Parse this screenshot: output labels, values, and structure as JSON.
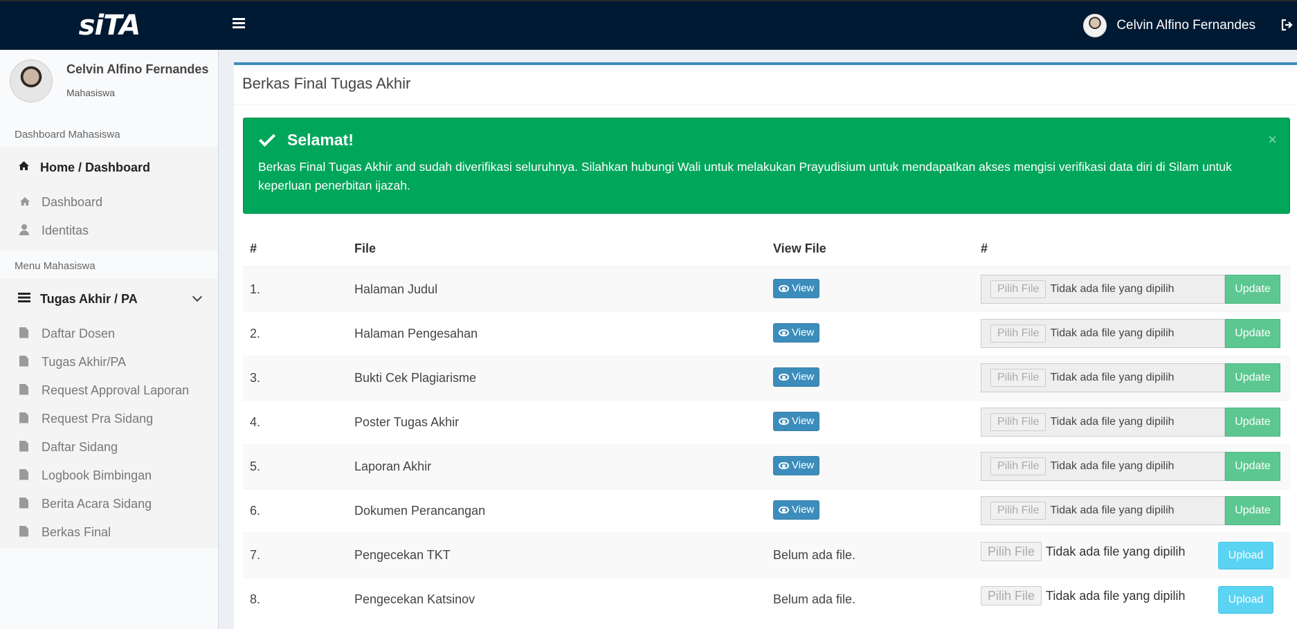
{
  "app": {
    "logo": "siTA",
    "user_name": "Celvin Alfino Fernandes"
  },
  "sidebar": {
    "user_name": "Celvin Alfino Fernandes",
    "user_role": "Mahasiswa",
    "section1": "Dashboard Mahasiswa",
    "home_label": "Home / Dashboard",
    "home_items": [
      {
        "label": "Dashboard",
        "icon": "home-icon"
      },
      {
        "label": "Identitas",
        "icon": "user-icon"
      }
    ],
    "section2": "Menu Mahasiswa",
    "ta_label": "Tugas Akhir / PA",
    "ta_items": [
      {
        "label": "Daftar Dosen"
      },
      {
        "label": "Tugas Akhir/PA"
      },
      {
        "label": "Request Approval Laporan"
      },
      {
        "label": "Request Pra Sidang"
      },
      {
        "label": "Daftar Sidang"
      },
      {
        "label": "Logbook Bimbingan"
      },
      {
        "label": "Berita Acara Sidang"
      },
      {
        "label": "Berkas Final"
      }
    ]
  },
  "main": {
    "title": "Berkas Final Tugas Akhir",
    "alert": {
      "heading": "Selamat!",
      "text": "Berkas Final Tugas Akhir and sudah diverifikasi seluruhnya. Silahkan hubungi Wali untuk melakukan Prayudisium untuk mendapatkan akses mengisi verifikasi data diri di Silam untuk keperluan penerbitan ijazah.",
      "close": "×",
      "color": "#00a65a"
    },
    "table": {
      "headers": [
        "#",
        "File",
        "View File",
        "#"
      ],
      "rows": [
        {
          "no": "1.",
          "file": "Halaman Judul",
          "view": "View",
          "choose": "Pilih File",
          "status": "Tidak ada file yang dipilih",
          "action": "Update"
        },
        {
          "no": "2.",
          "file": "Halaman Pengesahan",
          "view": "View",
          "choose": "Pilih File",
          "status": "Tidak ada file yang dipilih",
          "action": "Update"
        },
        {
          "no": "3.",
          "file": "Bukti Cek Plagiarisme",
          "view": "View",
          "choose": "Pilih File",
          "status": "Tidak ada file yang dipilih",
          "action": "Update"
        },
        {
          "no": "4.",
          "file": "Poster Tugas Akhir",
          "view": "View",
          "choose": "Pilih File",
          "status": "Tidak ada file yang dipilih",
          "action": "Update"
        },
        {
          "no": "5.",
          "file": "Laporan Akhir",
          "view": "View",
          "choose": "Pilih File",
          "status": "Tidak ada file yang dipilih",
          "action": "Update"
        },
        {
          "no": "6.",
          "file": "Dokumen Perancangan",
          "view": "View",
          "choose": "Pilih File",
          "status": "Tidak ada file yang dipilih",
          "action": "Update"
        },
        {
          "no": "7.",
          "file": "Pengecekan TKT",
          "view": "Belum ada file.",
          "choose": "Pilih File",
          "status": "Tidak ada file yang dipilih",
          "action": "Upload"
        },
        {
          "no": "8.",
          "file": "Pengecekan Katsinov",
          "view": "Belum ada file.",
          "choose": "Pilih File",
          "status": "Tidak ada file yang dipilih",
          "action": "Upload"
        }
      ]
    }
  }
}
